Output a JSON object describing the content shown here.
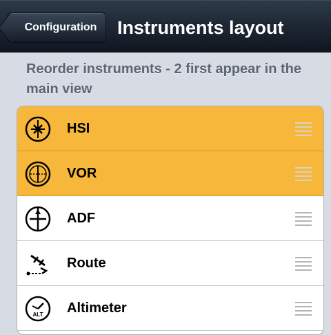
{
  "navbar": {
    "back_label": "Configuration",
    "title": "Instruments layout"
  },
  "section": {
    "header": "Reorder instruments - 2 first appear in the main view"
  },
  "instruments": [
    {
      "label": "HSI",
      "icon": "hsi-icon",
      "active": true
    },
    {
      "label": "VOR",
      "icon": "vor-icon",
      "active": true
    },
    {
      "label": "ADF",
      "icon": "adf-icon",
      "active": false
    },
    {
      "label": "Route",
      "icon": "route-icon",
      "active": false
    },
    {
      "label": "Altimeter",
      "icon": "altimeter-icon",
      "active": false
    }
  ],
  "icon_text": {
    "altimeter": "ALT"
  },
  "colors": {
    "highlight": "#f7b73a",
    "navbar": "#1f2936",
    "background": "#d7dce4"
  }
}
